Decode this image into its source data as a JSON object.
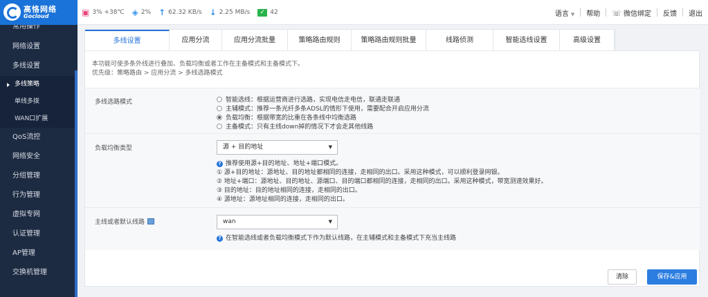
{
  "logo": {
    "name_cn": "高恪网络",
    "name_en": "Gocloud"
  },
  "status": {
    "cpu": "3% +38℃",
    "memory": "2%",
    "upload": "62.32 KB/s",
    "download": "2.25 MB/s",
    "connections": "42"
  },
  "topnav": {
    "language": "语言",
    "help": "帮助",
    "wechat_bind": "微信绑定",
    "feedback": "反馈",
    "logout": "退出"
  },
  "sidebar": {
    "partial_item": "常用操作",
    "items_top": [
      "网络设置",
      "多线设置"
    ],
    "sub_items": [
      "多线策略",
      "单线多拨",
      "WAN口扩展"
    ],
    "items_bottom": [
      "QoS流控",
      "网络安全",
      "分组管理",
      "行为管理",
      "虚拟专网",
      "认证管理",
      "AP管理",
      "交换机管理"
    ]
  },
  "tabs": [
    "多线设置",
    "应用分流",
    "应用分流批量",
    "策略路由规则",
    "策略路由规则批量",
    "线路侦测",
    "智能选线设置",
    "高级设置"
  ],
  "intro": {
    "line1": "本功能可使多条外线进行叠加、负载均衡或者工作在主备模式和主备模式下。",
    "line2": "优先级：策略路由 > 应用分流 > 多线选路模式"
  },
  "mode": {
    "label": "多线选路模式",
    "options": [
      "智能选线：根据运营商进行选路，实现电信走电信，联通走联通",
      "主辅模式：推荐一条光纤多条ADSL的情形下使用，需要配合开启应用分流",
      "负载均衡：根据带宽的比重在各条线中均衡选路",
      "主备模式：只有主线down掉的情况下才会走其他线路"
    ],
    "selected_index": 2
  },
  "balance": {
    "label": "负载均衡类型",
    "value": "源 + 目的地址",
    "help": [
      "推荐使用源+目的地址、地址+端口模式。",
      "① 源+目的地址：源地址、目的地址都相同的连接，走相同的出口。采用这种模式，可以顺利登录网银。",
      "② 地址+端口：源地址、目的地址、源端口、目的端口都相同的连接，走相同的出口。采用这种模式，带宽测速效果好。",
      "③ 目的地址：目的地址相同的连接，走相同的出口。",
      "④ 源地址：源地址相同的连接，走相同的出口。"
    ]
  },
  "default_line": {
    "label": "主线或者默认线路",
    "value": "wan",
    "help": "在智能选线或者负载均衡模式下作为默认线路，在主辅模式和主备模式下充当主线路"
  },
  "buttons": {
    "clear": "清除",
    "save": "保存&应用"
  }
}
